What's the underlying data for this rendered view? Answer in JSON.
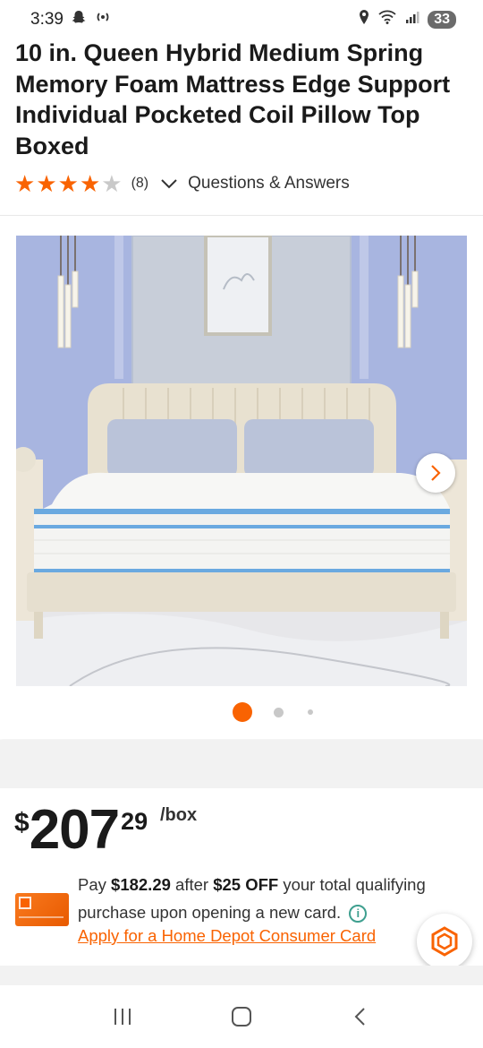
{
  "status_bar": {
    "time": "3:39",
    "battery": "33",
    "icons": [
      "snapchat-icon",
      "broadcast-icon",
      "location-icon",
      "wifi-icon",
      "signal-icon",
      "battery-icon"
    ]
  },
  "product": {
    "title": "10 in. Queen Hybrid Medium Spring Memory Foam Mattress Edge Support Individual Pocketed Coil Pillow Top Boxed",
    "rating": 4,
    "rating_max": 5,
    "review_count": "(8)",
    "qa_link": "Questions & Answers"
  },
  "gallery": {
    "image_count": 3,
    "active_index": 0,
    "icons": [
      "chevron-right-icon"
    ]
  },
  "pricing": {
    "currency": "$",
    "whole": "207",
    "cents": "29",
    "unit": "/box",
    "promo_pay": "Pay",
    "promo_price": "$182.29",
    "promo_after": "after",
    "promo_discount": "$25 OFF",
    "promo_rest": "your total qualifying purchase upon opening a new card.",
    "apply_link": "Apply for a Home Depot Consumer Card"
  },
  "colors": {
    "brand_orange": "#f96302",
    "info_teal": "#3e9f8f"
  },
  "nav_icons": [
    "recents-icon",
    "home-icon",
    "back-icon"
  ]
}
